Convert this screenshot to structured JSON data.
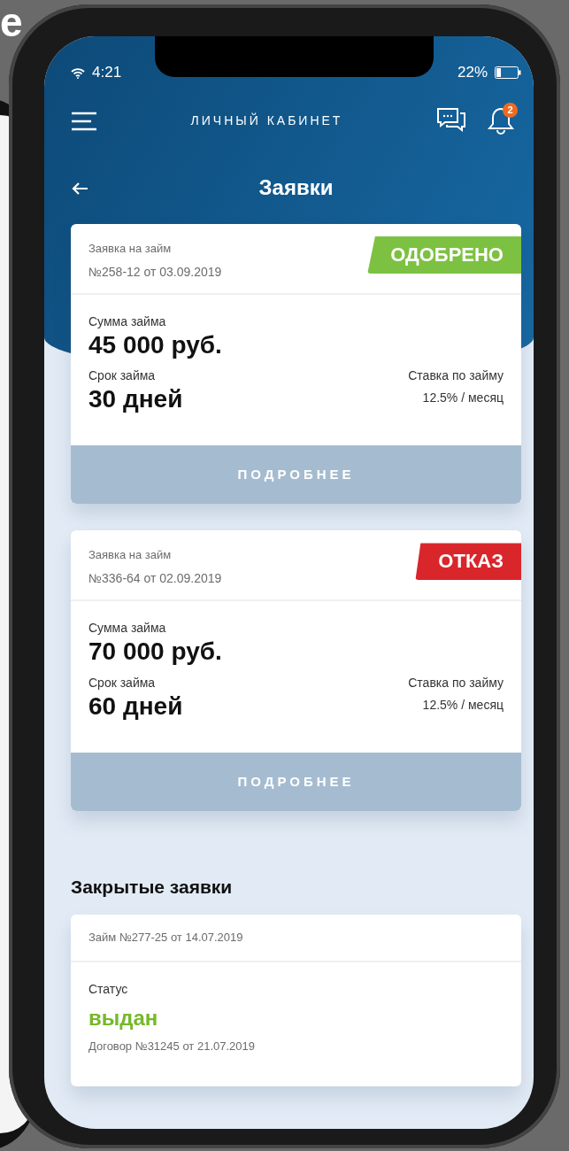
{
  "corner_text": "e",
  "status_bar": {
    "time": "4:21",
    "battery": "22%"
  },
  "nav": {
    "title": "ЛИЧНЫЙ КАБИНЕТ",
    "notification_count": "2"
  },
  "page_title": "Заявки",
  "applications": [
    {
      "title": "Заявка на займ",
      "number": "№258-12 от 03.09.2019",
      "status": "ОДОБРЕНО",
      "color": "#7dc142",
      "amount_label": "Сумма займа",
      "amount": "45 000 руб.",
      "term_label": "Срок займа",
      "term": "30 дней",
      "rate_label": "Ставка по займу",
      "rate": "12.5% / месяц",
      "button": "ПОДРОБНЕЕ"
    },
    {
      "title": "Заявка на займ",
      "number": "№336-64 от 02.09.2019",
      "status": "ОТКАЗ",
      "color": "#d9262b",
      "amount_label": "Сумма займа",
      "amount": "70 000 руб.",
      "term_label": "Срок займа",
      "term": "60 дней",
      "rate_label": "Ставка по займу",
      "rate": "12.5% / месяц",
      "button": "ПОДРОБНЕЕ"
    }
  ],
  "closed_section": {
    "title": "Закрытые заявки",
    "items": [
      {
        "loan": "Займ №277-25 от 14.07.2019",
        "status_label": "Статус",
        "status": "выдан",
        "contract": "Договор №31245 от 21.07.2019"
      }
    ]
  }
}
